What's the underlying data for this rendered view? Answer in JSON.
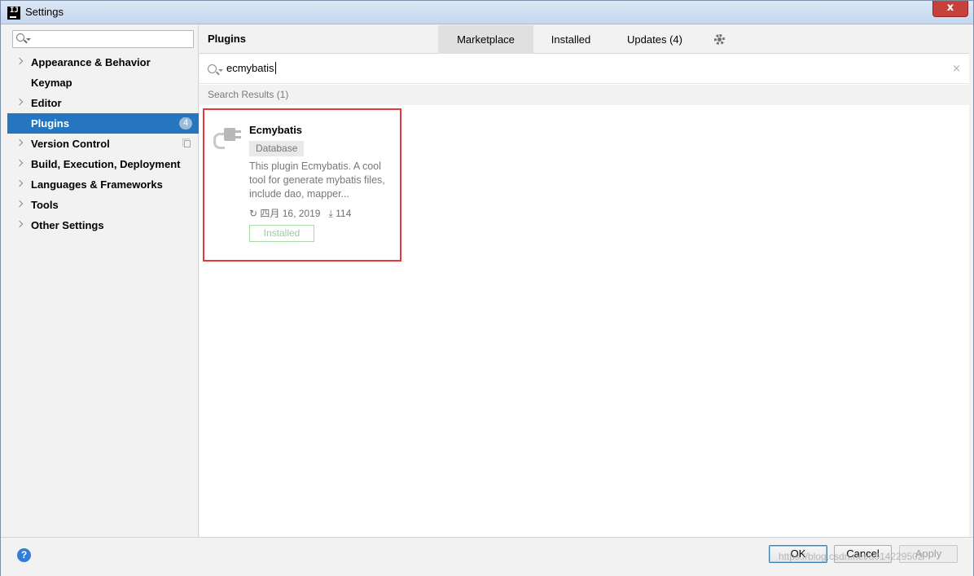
{
  "window": {
    "title": "Settings",
    "app_icon": "IJ",
    "close_icon": "x"
  },
  "sidebar": {
    "search": {
      "value": "",
      "placeholder": ""
    },
    "items": [
      {
        "label": "Appearance & Behavior",
        "expandable": true
      },
      {
        "label": "Keymap",
        "expandable": false
      },
      {
        "label": "Editor",
        "expandable": true
      },
      {
        "label": "Plugins",
        "expandable": false,
        "selected": true,
        "badge": "4"
      },
      {
        "label": "Version Control",
        "expandable": true
      },
      {
        "label": "Build, Execution, Deployment",
        "expandable": true
      },
      {
        "label": "Languages & Frameworks",
        "expandable": true
      },
      {
        "label": "Tools",
        "expandable": true
      },
      {
        "label": "Other Settings",
        "expandable": true
      }
    ]
  },
  "main": {
    "title": "Plugins",
    "tabs": [
      {
        "label": "Marketplace",
        "active": true
      },
      {
        "label": "Installed",
        "active": false
      },
      {
        "label": "Updates (4)",
        "active": false
      }
    ],
    "search": {
      "value": "ecmybatis",
      "clear_icon": "×"
    },
    "results_label": "Search Results (1)",
    "plugin": {
      "name": "Ecmybatis",
      "tag": "Database",
      "description": "This plugin Ecmybatis. A cool tool for generate mybatis files, include dao, mapper...",
      "date": "四月 16, 2019",
      "downloads": "114",
      "status_button": "Installed"
    }
  },
  "footer": {
    "help_icon": "?",
    "ok": "OK",
    "cancel": "Cancel",
    "apply": "Apply",
    "watermark": "https://blog.csdn.net/u014229502"
  },
  "colors": {
    "selection": "#2675bf",
    "highlight_border": "#e8383d",
    "installed_green": "#a9d9a9",
    "help_blue": "#2f7ed8"
  }
}
